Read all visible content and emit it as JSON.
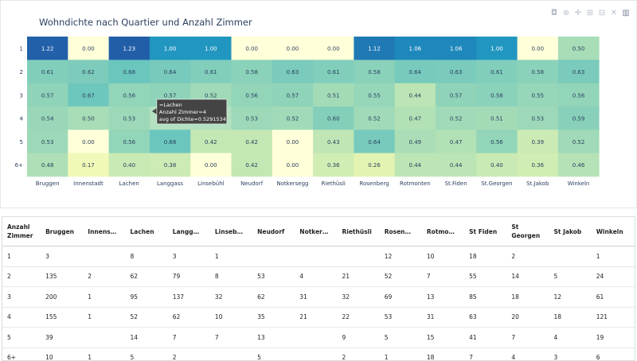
{
  "chart_data": {
    "type": "heatmap",
    "title": "Wohndichte nach Quartier und Anzahl Zimmer",
    "x": [
      "Bruggen",
      "Innenstadt",
      "Lachen",
      "Langgass",
      "Linsebühl",
      "Neudorf",
      "Notkersegg",
      "Riethüsli",
      "Rosenberg",
      "Rotmonten",
      "St.Fiden",
      "St.Georgen",
      "St.Jakob",
      "Winkeln"
    ],
    "y": [
      "1",
      "2",
      "3",
      "4",
      "5",
      "6+"
    ],
    "z": [
      [
        1.22,
        0.0,
        1.23,
        1.0,
        1.0,
        0.0,
        0.0,
        0.0,
        1.12,
        1.06,
        1.06,
        1.0,
        0.0,
        0.5
      ],
      [
        0.61,
        0.62,
        0.68,
        0.64,
        0.61,
        0.58,
        0.63,
        0.61,
        0.58,
        0.64,
        0.63,
        0.61,
        0.58,
        0.63
      ],
      [
        0.57,
        0.67,
        0.56,
        0.57,
        0.52,
        0.56,
        0.57,
        0.51,
        0.55,
        0.44,
        0.57,
        0.58,
        0.55,
        0.56
      ],
      [
        0.54,
        0.5,
        0.53,
        null,
        null,
        0.53,
        0.52,
        0.6,
        0.52,
        0.47,
        0.52,
        0.51,
        0.53,
        0.59
      ],
      [
        0.53,
        0.0,
        0.56,
        0.68,
        0.42,
        0.42,
        0.0,
        0.43,
        0.64,
        0.49,
        0.47,
        0.56,
        0.39,
        0.52
      ],
      [
        0.48,
        0.17,
        0.4,
        0.38,
        0.0,
        0.42,
        0.0,
        0.36,
        0.26,
        0.44,
        0.44,
        0.4,
        0.36,
        0.46
      ]
    ],
    "zlim": [
      0,
      1.23
    ],
    "colorscale": [
      "#ffffd9",
      "#edf8b1",
      "#c7e9b4",
      "#7fcdbb",
      "#41b6c4",
      "#1d91c0",
      "#225ea8"
    ],
    "tooltip": {
      "row": 3,
      "col": 2,
      "lines": [
        "=Lachen",
        "Anzahl Zimmer=4",
        "avg of Dichte=0.5291534"
      ]
    }
  },
  "modebar": {
    "icons": [
      "camera-icon",
      "zoom-icon",
      "pan-icon",
      "zoom-in-icon",
      "zoom-out-icon",
      "autoscale-icon",
      "plotly-logo-icon"
    ],
    "glyphs": [
      "◘",
      "⊕",
      "✛",
      "⊞",
      "⊟",
      "✕",
      "▥"
    ]
  },
  "table": {
    "headers": [
      "Anzahl Zimmer",
      "Bruggen",
      "Innens…",
      "Lachen",
      "Langg…",
      "Linseb…",
      "Neudorf",
      "Notker…",
      "Riethüsli",
      "Rosen…",
      "Rotmo…",
      "St Fiden",
      "St Georgen",
      "St Jakob",
      "Winkeln"
    ],
    "rows": [
      [
        "1",
        "3",
        "",
        "8",
        "3",
        "1",
        "",
        "",
        "",
        "12",
        "10",
        "18",
        "2",
        "",
        "1"
      ],
      [
        "2",
        "135",
        "2",
        "62",
        "79",
        "8",
        "53",
        "4",
        "21",
        "52",
        "7",
        "55",
        "14",
        "5",
        "24"
      ],
      [
        "3",
        "200",
        "1",
        "95",
        "137",
        "32",
        "62",
        "31",
        "32",
        "69",
        "13",
        "85",
        "18",
        "12",
        "61"
      ],
      [
        "4",
        "155",
        "1",
        "52",
        "62",
        "10",
        "35",
        "21",
        "22",
        "53",
        "31",
        "63",
        "20",
        "18",
        "121"
      ],
      [
        "5",
        "39",
        "",
        "14",
        "7",
        "7",
        "13",
        "",
        "9",
        "5",
        "15",
        "41",
        "7",
        "4",
        "19"
      ],
      [
        "6+",
        "10",
        "1",
        "5",
        "2",
        "",
        "5",
        "",
        "2",
        "1",
        "18",
        "7",
        "4",
        "3",
        "6"
      ]
    ]
  }
}
